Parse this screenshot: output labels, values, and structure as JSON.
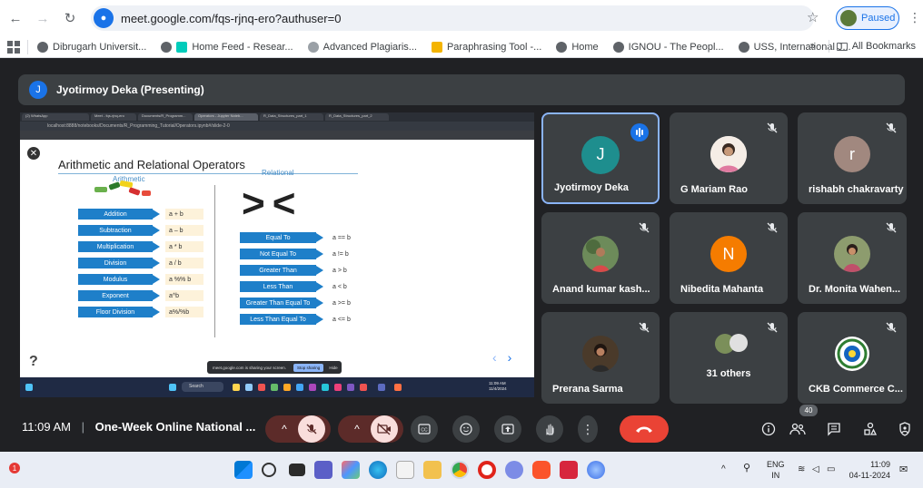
{
  "browser": {
    "url": "meet.google.com/fqs-rjnq-ero?authuser=0",
    "profile_status": "Paused"
  },
  "bookmarks": {
    "items": [
      "Dibrugarh Universit...",
      "Home Feed - Resear...",
      "Advanced Plagiaris...",
      "Paraphrasing Tool -...",
      "Home",
      "IGNOU - The Peopl...",
      "USS, International J..."
    ],
    "more": "»",
    "all_bookmarks": "All Bookmarks"
  },
  "meet": {
    "presenter_initial": "J",
    "presenter_label": "Jyotirmoy Deka (Presenting)",
    "clock": "11:09 AM",
    "separator": "|",
    "meeting_title": "One-Week Online National ...",
    "participant_count": "40"
  },
  "shared_screen": {
    "tabs": [
      "(2) WhatsApp",
      "Meet - fqs-rjnq-ero",
      "Documents/R_Programm...",
      "Operators - Jupyter Noteb...",
      "R_Data_Structures_part_1",
      "R_Data_Structures_part_2"
    ],
    "address": "localhost:8888/notebooks/Documents/R_Programming_Tutorial/Operators.ipynb#/slide-2-0",
    "slide_title": "Arithmetic and Relational Operators",
    "arithmetic_header": "Arithmetic",
    "relational_header": "Relational",
    "relational_symbol": "><",
    "arithmetic": [
      {
        "label": "Addition",
        "expr": "a + b"
      },
      {
        "label": "Subtraction",
        "expr": "a – b"
      },
      {
        "label": "Multiplication",
        "expr": "a * b"
      },
      {
        "label": "Division",
        "expr": "a / b"
      },
      {
        "label": "Modulus",
        "expr": "a %% b"
      },
      {
        "label": "Exponent",
        "expr": "a^b"
      },
      {
        "label": "Floor Division",
        "expr": "a%/%b"
      }
    ],
    "relational": [
      {
        "label": "Equal To",
        "expr": "a == b"
      },
      {
        "label": "Not Equal To",
        "expr": "a != b"
      },
      {
        "label": "Greater Than",
        "expr": "a > b"
      },
      {
        "label": "Less Than",
        "expr": "a < b"
      },
      {
        "label": "Greater Than Equal To",
        "expr": "a >= b"
      },
      {
        "label": "Less Than Equal To",
        "expr": "a <= b"
      }
    ],
    "help_mark": "?",
    "nav_prev": "‹",
    "nav_next": "›",
    "share_notice": "meet.google.com is sharing your screen.",
    "stop_sharing": "Stop sharing",
    "hide": "Hide",
    "taskbar_search": "Search",
    "taskbar_time": "11:09 AM",
    "taskbar_date": "11/4/2024"
  },
  "participants": [
    {
      "name": "Jyotirmoy Deka",
      "initial": "J",
      "avatar_color": "#1e8e8e",
      "speaking": true
    },
    {
      "name": "G Mariam Rao",
      "initial": "",
      "avatar_color": "#f4e4d4",
      "speaking": false
    },
    {
      "name": "rishabh chakravarty",
      "initial": "r",
      "avatar_color": "#a1887f",
      "speaking": false
    },
    {
      "name": "Anand kumar kash...",
      "initial": "",
      "avatar_color": "#6d8b5a",
      "speaking": false
    },
    {
      "name": "Nibedita Mahanta",
      "initial": "N",
      "avatar_color": "#f57c00",
      "speaking": false
    },
    {
      "name": "Dr. Monita Wahen...",
      "initial": "",
      "avatar_color": "#8d9c6e",
      "speaking": false
    },
    {
      "name": "Prerana Sarma",
      "initial": "",
      "avatar_color": "#5a4a3a",
      "speaking": false
    },
    {
      "name": "31 others",
      "initial": "",
      "avatar_color": "#7b8f5a",
      "speaking": false
    },
    {
      "name": "CKB Commerce C...",
      "initial": "",
      "avatar_color": "#e8eef8",
      "speaking": false
    }
  ],
  "taskbar": {
    "notification_count": "1",
    "lang_top": "ENG",
    "lang_bottom": "IN",
    "time": "11:09",
    "date": "04-11-2024"
  },
  "colors": {
    "meet_bg": "#202124",
    "tile_bg": "#3c4043",
    "accent": "#1a73e8",
    "hangup": "#ea4335",
    "slide_blue": "#1e7fc9"
  }
}
